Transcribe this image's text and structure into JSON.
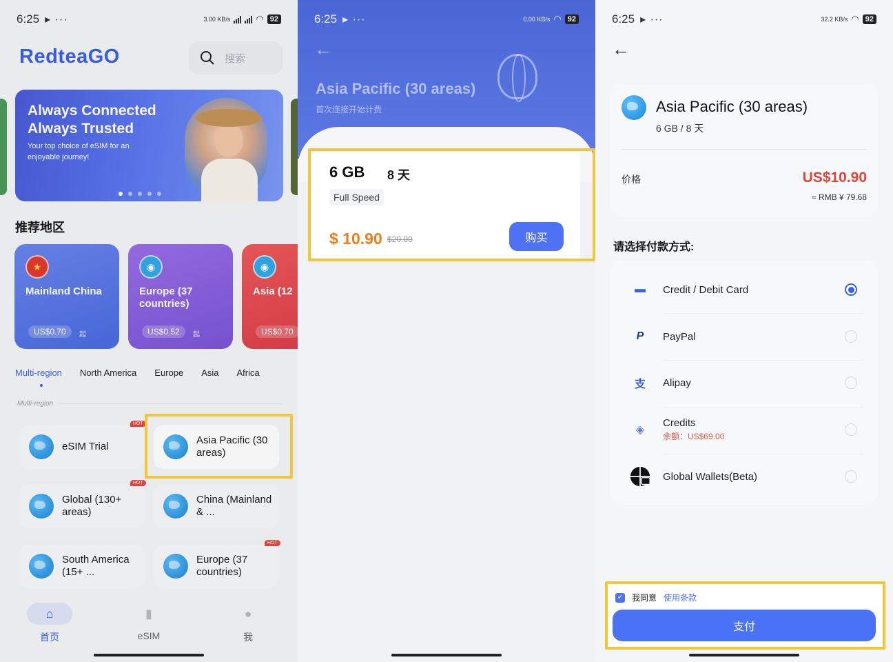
{
  "status": [
    {
      "time": "6:25",
      "speed": "3.00 KB/s",
      "battery": "92"
    },
    {
      "time": "6:25",
      "speed": "0.00 KB/s",
      "battery": "92"
    },
    {
      "time": "6:25",
      "speed": "32.2 KB/s",
      "battery": "92"
    }
  ],
  "home": {
    "logo": "RedteaGO",
    "search_placeholder": "搜索",
    "banner": {
      "title": "Always Connected Always Trusted",
      "subtitle": "Your top choice of eSIM for an enjoyable journey!"
    },
    "section_title": "推荐地区",
    "region_cards": [
      {
        "name": "Mainland China",
        "price": "US$0.70",
        "suffix": "起",
        "color": "#5b7de8",
        "flag": "★"
      },
      {
        "name": "Europe (37 countries)",
        "price": "US$0.52",
        "suffix": "起",
        "color": "#8b62e0",
        "flag": "◉"
      },
      {
        "name": "Asia (12",
        "price": "US$0.70",
        "suffix": "",
        "color": "#e4474f",
        "flag": "◉"
      }
    ],
    "tabs": [
      "Multi-region",
      "North America",
      "Europe",
      "Asia",
      "Africa"
    ],
    "list_label": "Multi-region",
    "items": [
      {
        "name": "eSIM Trial",
        "hot": "HOT"
      },
      {
        "name": "Asia Pacific (30 areas)",
        "hot": ""
      },
      {
        "name": "Global (130+ areas)",
        "hot": "HOT"
      },
      {
        "name": "China (Mainland & ...",
        "hot": ""
      },
      {
        "name": "South America (15+ ...",
        "hot": ""
      },
      {
        "name": "Europe (37 countries)",
        "hot": "HOT"
      }
    ],
    "nav": [
      {
        "label": "首页",
        "icon": "home-icon"
      },
      {
        "label": "eSIM",
        "icon": "sim-icon"
      },
      {
        "label": "我",
        "icon": "user-icon"
      }
    ]
  },
  "detail": {
    "title": "Asia Pacific (30 areas)",
    "subtitle": "首次连接开始计费",
    "plan": {
      "data": "6 GB",
      "days": "8 天",
      "speed": "Full Speed",
      "price": "$ 10.90",
      "original": "$20.00",
      "buy": "购买"
    }
  },
  "checkout": {
    "product": "Asia Pacific (30 areas)",
    "spec": "6 GB / 8 天",
    "price_label": "价格",
    "price": "US$10.90",
    "rmb": "≈ RMB ¥ 79.68",
    "pay_title": "请选择付款方式:",
    "methods": [
      {
        "name": "Credit / Debit Card",
        "icon": "credit-card-icon",
        "selected": true,
        "sub": ""
      },
      {
        "name": "PayPal",
        "icon": "paypal-icon",
        "selected": false,
        "sub": ""
      },
      {
        "name": "Alipay",
        "icon": "alipay-icon",
        "selected": false,
        "sub": ""
      },
      {
        "name": "Credits",
        "icon": "wallet-icon",
        "selected": false,
        "sub": "余额：US$69.00"
      },
      {
        "name": "Global Wallets(Beta)",
        "icon": "globe-wallet-icon",
        "selected": false,
        "sub": ""
      }
    ],
    "agree": "我同意",
    "terms": "使用条款",
    "pay_button": "支付"
  }
}
